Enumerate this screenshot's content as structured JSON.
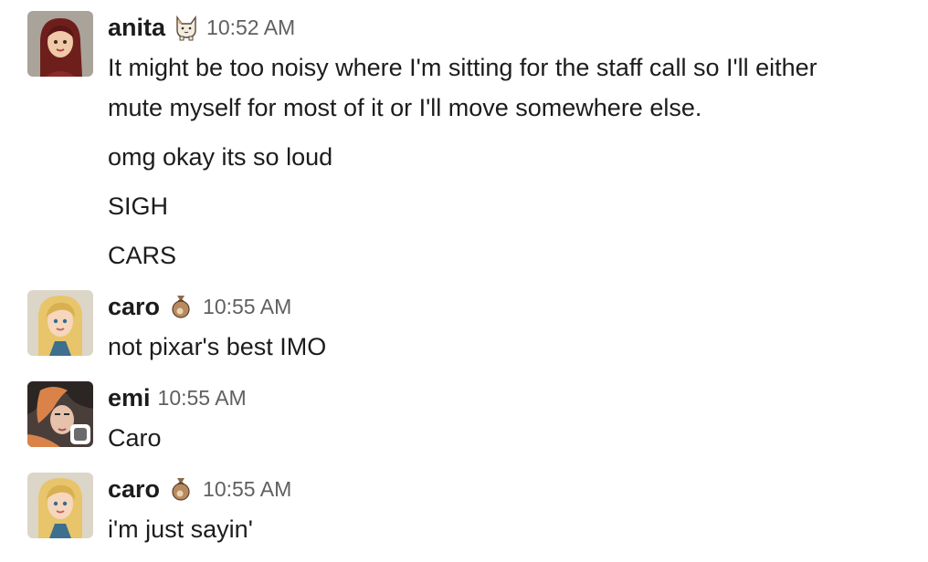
{
  "messages": [
    {
      "author": "anita",
      "status_emoji": "cat-emoji",
      "time": "10:52 AM",
      "lines": [
        "It might be too noisy where I'm sitting for the staff call so I'll either",
        "mute myself for most of it or I'll move somewhere else.",
        "omg okay its so loud",
        "SIGH",
        "CARS"
      ]
    },
    {
      "author": "caro",
      "status_emoji": "money-bag-emoji",
      "time": "10:55 AM",
      "lines": [
        "not pixar's best IMO"
      ]
    },
    {
      "author": "emi",
      "status_emoji": "",
      "presence": "away",
      "time": "10:55 AM",
      "lines": [
        "Caro"
      ]
    },
    {
      "author": "caro",
      "status_emoji": "money-bag-emoji",
      "time": "10:55 AM",
      "lines": [
        "i'm just sayin'"
      ]
    }
  ],
  "colors": {
    "text": "#1d1c1d",
    "timestamp": "#616061",
    "presence_away": "#6b6b6b",
    "background": "#ffffff"
  }
}
